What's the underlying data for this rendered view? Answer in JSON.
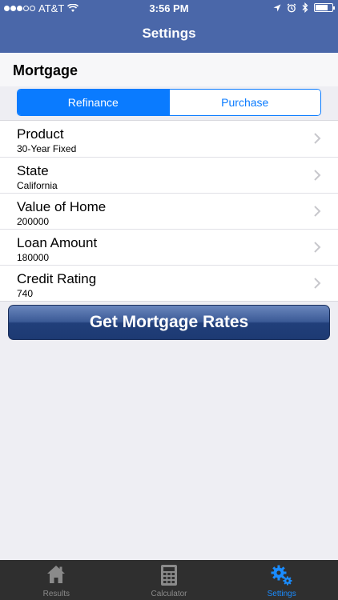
{
  "status": {
    "carrier": "AT&T",
    "time": "3:56 PM"
  },
  "header": {
    "title": "Settings"
  },
  "section": {
    "title": "Mortgage"
  },
  "segmented": {
    "options": [
      "Refinance",
      "Purchase"
    ],
    "selected": "Refinance"
  },
  "settings": {
    "rows": [
      {
        "label": "Product",
        "value": "30-Year Fixed"
      },
      {
        "label": "State",
        "value": "California"
      },
      {
        "label": "Value of Home",
        "value": "200000"
      },
      {
        "label": "Loan Amount",
        "value": "180000"
      },
      {
        "label": "Credit Rating",
        "value": "740"
      }
    ]
  },
  "cta": {
    "label": "Get Mortgage Rates"
  },
  "tabbar": {
    "tabs": [
      {
        "label": "Results",
        "icon": "home-icon"
      },
      {
        "label": "Calculator",
        "icon": "calculator-icon"
      },
      {
        "label": "Settings",
        "icon": "gear-icon"
      }
    ],
    "active": "Settings"
  },
  "colors": {
    "nav_bar": "#4a67a9",
    "accent": "#0a7bff",
    "tab_active": "#1a8cff"
  }
}
